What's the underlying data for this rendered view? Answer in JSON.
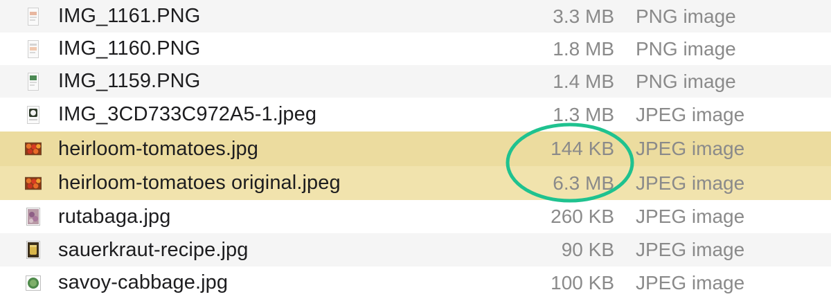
{
  "files": [
    {
      "name": "IMG_1161.PNG",
      "size": "3.3 MB",
      "kind": "PNG image",
      "icon": "png-thumbnail-icon"
    },
    {
      "name": "IMG_1160.PNG",
      "size": "1.8 MB",
      "kind": "PNG image",
      "icon": "png-thumbnail-icon"
    },
    {
      "name": "IMG_1159.PNG",
      "size": "1.4 MB",
      "kind": "PNG image",
      "icon": "png-thumbnail-icon"
    },
    {
      "name": "IMG_3CD733C972A5-1.jpeg",
      "size": "1.3 MB",
      "kind": "JPEG image",
      "icon": "jpeg-thumbnail-icon"
    },
    {
      "name": "heirloom-tomatoes.jpg",
      "size": "144 KB",
      "kind": "JPEG image",
      "icon": "tomatoes-thumbnail-icon"
    },
    {
      "name": "heirloom-tomatoes original.jpeg",
      "size": "6.3 MB",
      "kind": "JPEG image",
      "icon": "tomatoes-thumbnail-icon"
    },
    {
      "name": "rutabaga.jpg",
      "size": "260 KB",
      "kind": "JPEG image",
      "icon": "rutabaga-thumbnail-icon"
    },
    {
      "name": "sauerkraut-recipe.jpg",
      "size": "90 KB",
      "kind": "JPEG image",
      "icon": "sauerkraut-thumbnail-icon"
    },
    {
      "name": "savoy-cabbage.jpg",
      "size": "100 KB",
      "kind": "JPEG image",
      "icon": "cabbage-thumbnail-icon"
    }
  ],
  "colors": {
    "selection": "#eedfa6",
    "stripe": "#f5f5f5",
    "annotation": "#1fc28f"
  }
}
